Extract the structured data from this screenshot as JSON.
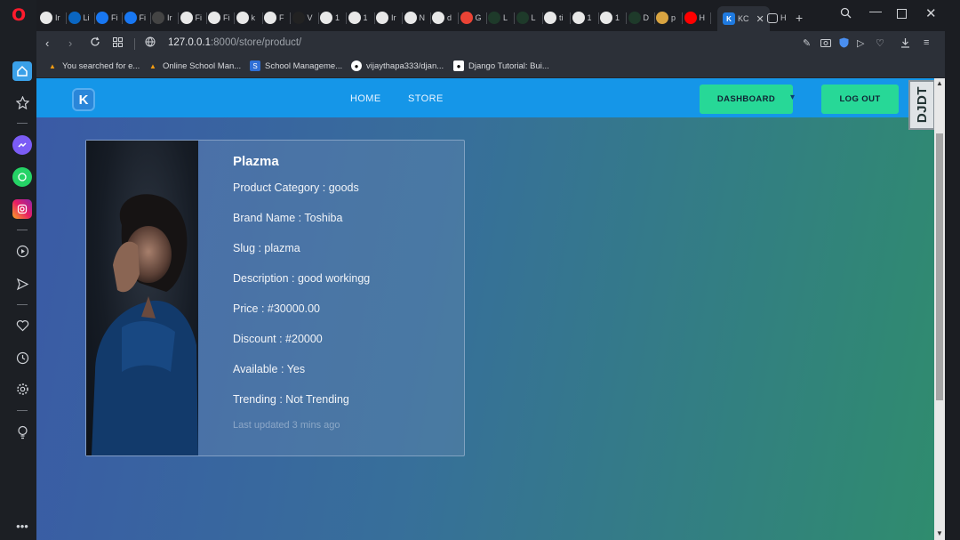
{
  "browser": {
    "tabs": [
      {
        "label": "Ir"
      },
      {
        "label": "Li"
      },
      {
        "label": "Fi"
      },
      {
        "label": "Fi"
      },
      {
        "label": "Ir"
      },
      {
        "label": "Fi"
      },
      {
        "label": "Fi"
      },
      {
        "label": "k"
      },
      {
        "label": "F"
      },
      {
        "label": "V"
      },
      {
        "label": "1"
      },
      {
        "label": "1"
      },
      {
        "label": "Ir"
      },
      {
        "label": "N"
      },
      {
        "label": "d"
      },
      {
        "label": "G"
      },
      {
        "label": "L"
      },
      {
        "label": "L"
      },
      {
        "label": "ti"
      },
      {
        "label": "1"
      },
      {
        "label": "1"
      },
      {
        "label": "D"
      },
      {
        "label": "p"
      },
      {
        "label": "H"
      }
    ],
    "active_tab": {
      "label": "KC"
    },
    "last_tab": {
      "label": "H"
    },
    "new_tab": "+",
    "url_host": "127.0.0.1",
    "url_path": ":8000/store/product/",
    "bookmarks": [
      {
        "label": "You searched for e..."
      },
      {
        "label": "Online School Man..."
      },
      {
        "label": "School Manageme..."
      },
      {
        "label": "vijaythapa333/djan..."
      },
      {
        "label": "Django Tutorial: Bui..."
      }
    ]
  },
  "site": {
    "logo_letter": "K",
    "nav": {
      "home": "HOME",
      "store": "STORE"
    },
    "dashboard_label": "DASHBOARD",
    "logout_label": "LOG OUT",
    "debug_toolbar_label": "DJDT"
  },
  "product": {
    "title": "Plazma",
    "fields": [
      "Product Category : goods",
      "Brand Name : Toshiba",
      "Slug : plazma",
      "Description : good workingg",
      "Price : #30000.00",
      "Discount : #20000",
      "Available : Yes",
      "Trending : Not Trending"
    ],
    "last_updated": "Last updated 3 mins ago"
  },
  "colors": {
    "navbar": "#1596e8",
    "cta_green": "#27d897",
    "opera_red": "#ff1b2d"
  }
}
